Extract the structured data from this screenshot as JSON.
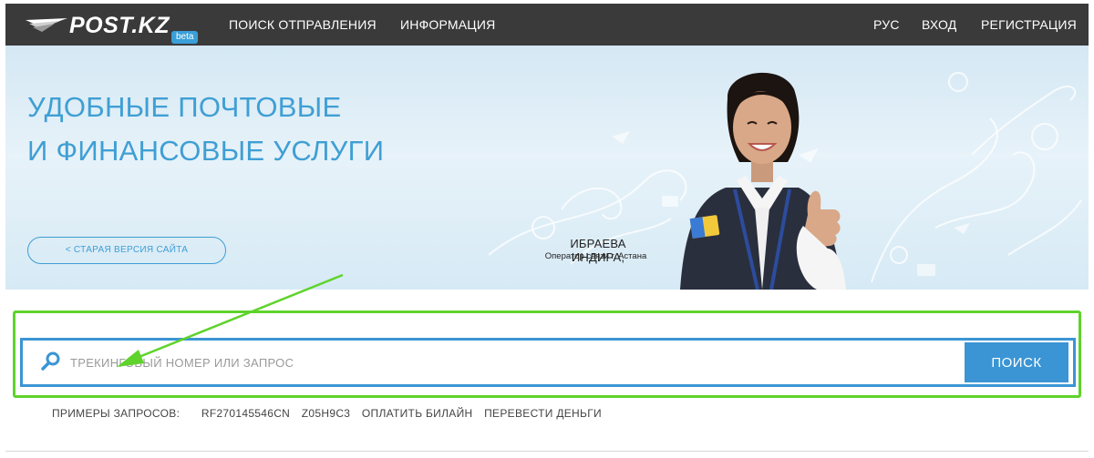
{
  "header": {
    "logo_text": "POST.KZ",
    "beta_label": "beta",
    "nav": {
      "tracking": "ПОИСК ОТПРАВЛЕНИЯ",
      "info": "ИНФОРМАЦИЯ",
      "lang": "РУС",
      "login": "ВХОД",
      "register": "РЕГИСТРАЦИЯ"
    }
  },
  "hero": {
    "title_line1": "УДОБНЫЕ ПОЧТОВЫЕ",
    "title_line2": "И ФИНАНСОВЫЕ УСЛУГИ",
    "old_site_label": "< СТАРАЯ ВЕРСИЯ САЙТА",
    "person_name": "ИБРАЕВА ИНДИРА,",
    "person_role": "Оператор связи г. Астана"
  },
  "search": {
    "placeholder": "ТРЕКИНГОВЫЙ НОМЕР ИЛИ ЗАПРОС",
    "button_label": "ПОИСК"
  },
  "examples": {
    "label": "ПРИМЕРЫ ЗАПРОСОВ:",
    "items": [
      "RF270145546CN",
      "Z05H9C3",
      "ОПЛАТИТЬ БИЛАЙН",
      "ПЕРЕВЕСТИ ДЕНЬГИ"
    ]
  },
  "colors": {
    "nav_bg": "#3a3a3a",
    "brand_blue": "#3b95d4",
    "hero_title": "#3f9fd4",
    "highlight_green": "#5fd32b"
  }
}
